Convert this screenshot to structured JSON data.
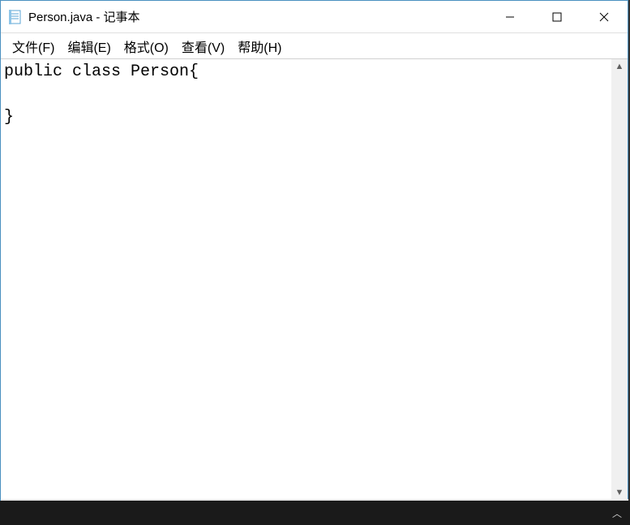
{
  "window": {
    "title": "Person.java - 记事本"
  },
  "menu": {
    "file": "文件(F)",
    "edit": "编辑(E)",
    "format": "格式(O)",
    "view": "查看(V)",
    "help": "帮助(H)"
  },
  "editor": {
    "content": "public class Person{\n\n}"
  }
}
